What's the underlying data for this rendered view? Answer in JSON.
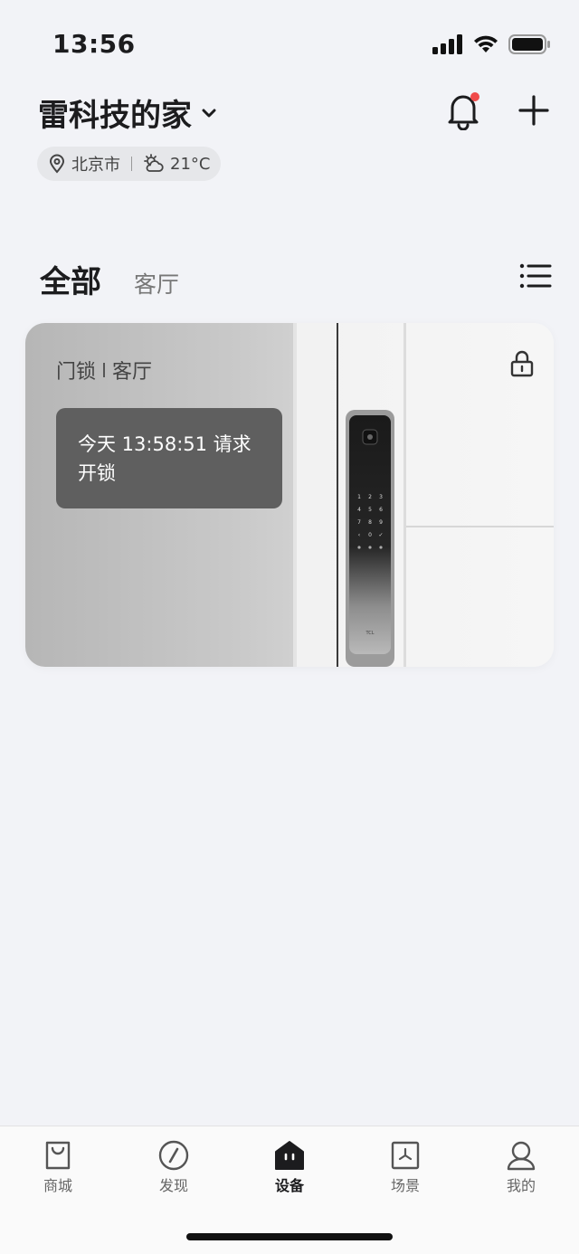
{
  "status_bar": {
    "time": "13:56"
  },
  "header": {
    "home_name": "雷科技的家"
  },
  "location": {
    "city": "北京市",
    "temperature": "21°C"
  },
  "tabs": [
    {
      "label": "全部",
      "active": true
    },
    {
      "label": "客厅",
      "active": false
    }
  ],
  "device_card": {
    "type": "门锁",
    "room": "客厅",
    "message": "今天 13:58:51 请求开锁",
    "brand": "TCL"
  },
  "bottom_nav": [
    {
      "label": "商城",
      "icon": "shopping-bag-icon",
      "active": false
    },
    {
      "label": "发现",
      "icon": "compass-icon",
      "active": false
    },
    {
      "label": "设备",
      "icon": "device-home-icon",
      "active": true
    },
    {
      "label": "场景",
      "icon": "scene-icon",
      "active": false
    },
    {
      "label": "我的",
      "icon": "profile-icon",
      "active": false
    }
  ],
  "colors": {
    "background": "#f2f3f7",
    "notification_dot": "#f04a4a",
    "message_box": "#5f5f5f"
  }
}
